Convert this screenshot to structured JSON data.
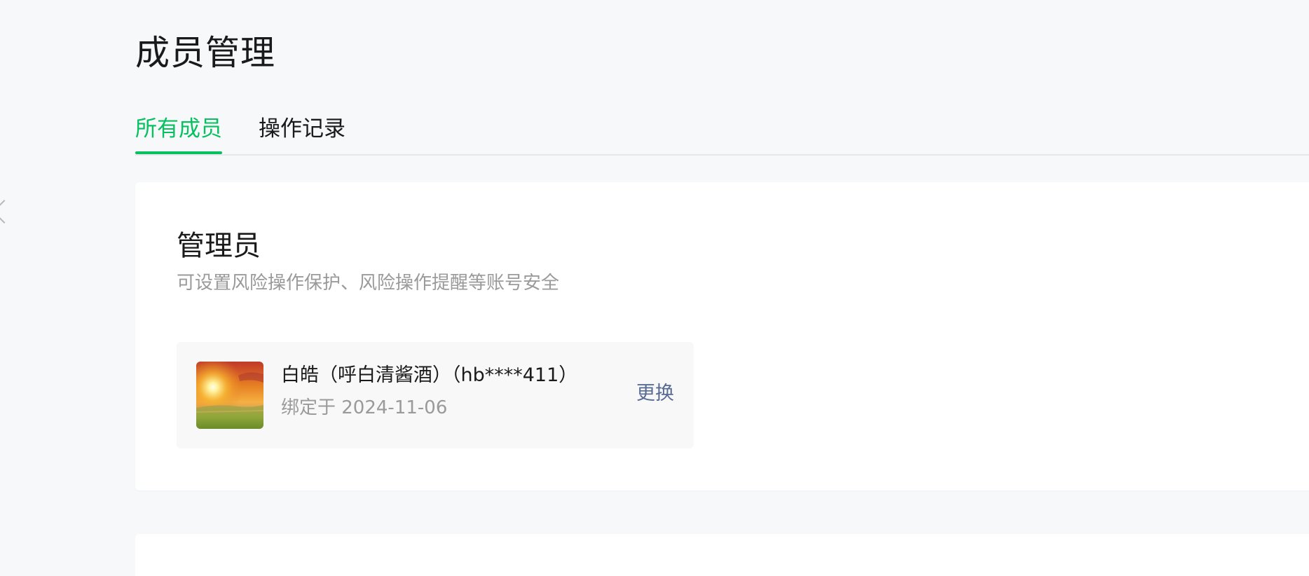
{
  "page": {
    "title": "成员管理"
  },
  "tabs": [
    {
      "label": "所有成员",
      "active": true
    },
    {
      "label": "操作记录",
      "active": false
    }
  ],
  "admin_section": {
    "title": "管理员",
    "description": "可设置风险操作保护、风险操作提醒等账号安全",
    "admin": {
      "name": "白皓（呼白清酱酒）（hb****411）",
      "bound_label": "绑定于 2024-11-06",
      "avatar_icon": "sunset-landscape-avatar",
      "change_label": "更换"
    }
  },
  "colors": {
    "accent": "#07c160",
    "link": "#576b95",
    "secondary_text": "#9a9a9a",
    "background": "#f7f8fa"
  }
}
